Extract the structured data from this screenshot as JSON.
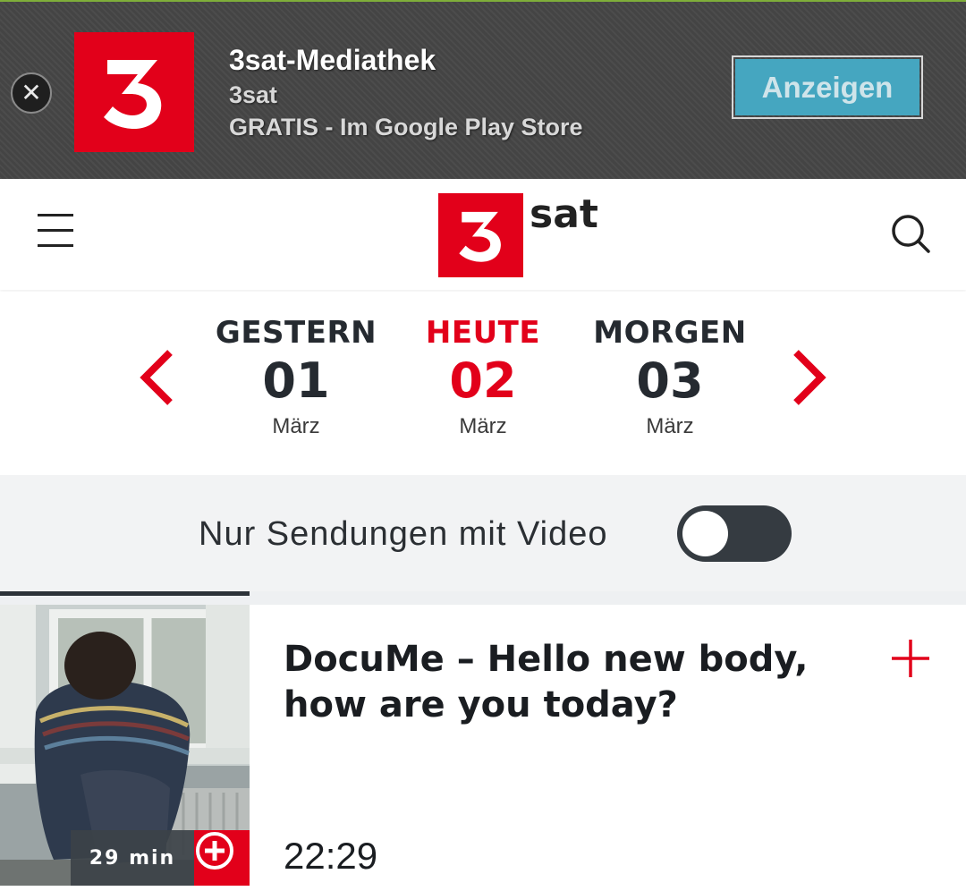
{
  "banner": {
    "close_icon": "close-icon",
    "app_name": "3sat-Mediathek",
    "publisher": "3sat",
    "price_text": "GRATIS - Im Google Play Store",
    "cta_label": "Anzeigen",
    "logo_glyph": "3",
    "accent_color": "#e2001a",
    "cta_color": "#45a6c0"
  },
  "header": {
    "menu_icon": "hamburger-menu-icon",
    "logo_text": "sat",
    "logo_glyph": "3",
    "search_icon": "search-icon"
  },
  "date_nav": {
    "prev_icon": "chevron-left-icon",
    "next_icon": "chevron-right-icon",
    "days": [
      {
        "label": "GESTERN",
        "day": "01",
        "month": "März",
        "active": false
      },
      {
        "label": "HEUTE",
        "day": "02",
        "month": "März",
        "active": true
      },
      {
        "label": "MORGEN",
        "day": "03",
        "month": "März",
        "active": false
      }
    ]
  },
  "filter": {
    "label": "Nur Sendungen mit Video",
    "toggle_on": false
  },
  "program": {
    "title": "DocuMe – Hello new body, how are you today?",
    "time": "22:29",
    "duration": "29 min",
    "add_icon": "plus-icon",
    "thumb_add_icon": "plus-circle-icon"
  }
}
